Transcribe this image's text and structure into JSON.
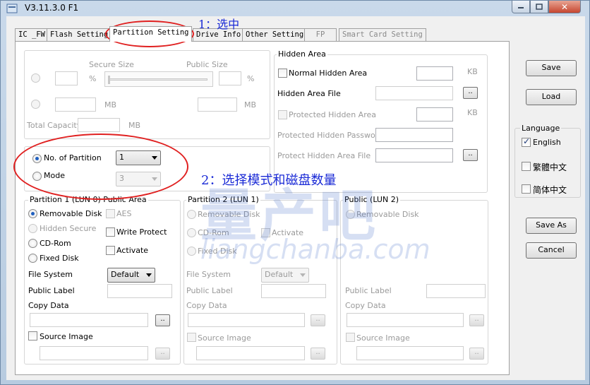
{
  "window": {
    "title": "V3.11.3.0 F1",
    "close_glyph": "✕"
  },
  "tabs": [
    {
      "label": "IC _FW",
      "active": false,
      "enabled": true
    },
    {
      "label": "Flash Setting",
      "active": false,
      "enabled": true
    },
    {
      "label": "Partition Setting",
      "active": true,
      "enabled": true
    },
    {
      "label": "Drive Info",
      "active": false,
      "enabled": true
    },
    {
      "label": "Other Setting",
      "active": false,
      "enabled": true
    },
    {
      "label": "FP",
      "active": false,
      "enabled": false
    },
    {
      "label": "Smart Card Setting",
      "active": false,
      "enabled": false
    }
  ],
  "top_left": {
    "secure_size_label": "Secure Size",
    "public_size_label": "Public Size",
    "percent": "%",
    "mb": "MB",
    "total_capacity_label": "Total Capacity"
  },
  "partition_mode": {
    "num_partition_label": "No. of Partition",
    "num_partition_value": "1",
    "mode_label": "Mode",
    "mode_value": "3"
  },
  "hidden_area": {
    "title": "Hidden Area",
    "normal_hidden_label": "Normal Hidden Area",
    "kb": "KB",
    "hidden_file_label": "Hidden Area File",
    "protected_hidden_label": "Protected Hidden Area",
    "protected_password_label": "Protected Hidden Password",
    "protect_file_label": "Protect Hidden Area File"
  },
  "partition1": {
    "title": "Partition 1 (LUN 0) Public Area",
    "removable_disk": "Removable Disk",
    "hidden_secure": "Hidden Secure",
    "cd_rom": "CD-Rom",
    "fixed_disk": "Fixed Disk",
    "aes": "AES",
    "write_protect": "Write Protect",
    "activate": "Activate",
    "file_system_label": "File System",
    "file_system_value": "Default",
    "public_label": "Public Label",
    "copy_data": "Copy Data",
    "source_image": "Source Image"
  },
  "partition2": {
    "title": "Partition 2 (LUN 1)",
    "removable_disk": "Removable Disk",
    "cd_rom": "CD-Rom",
    "fixed_disk": "Fixed Disk",
    "activate": "Activate",
    "file_system_label": "File System",
    "file_system_value": "Default",
    "public_label": "Public Label",
    "copy_data": "Copy Data",
    "source_image": "Source Image"
  },
  "public_lun2": {
    "title": "Public (LUN 2)",
    "removable_disk": "Removable Disk",
    "public_label": "Public Label",
    "copy_data": "Copy Data",
    "source_image": "Source Image"
  },
  "browse_label": "..",
  "right_panel": {
    "save": "Save",
    "load": "Load",
    "language_title": "Language",
    "english": "English",
    "trad_chinese": "繁體中文",
    "simp_chinese": "简体中文",
    "save_as": "Save As",
    "cancel": "Cancel"
  },
  "annotations": {
    "step1": "1：选中",
    "step2": "2：选择模式和磁盘数量"
  },
  "watermark": {
    "main": "量产吧",
    "url": "liangchanba.com"
  },
  "colors": {
    "annotation_blue": "#1a2ad6",
    "annotation_red": "#e02020",
    "titlebar": "#c9d9ea"
  }
}
